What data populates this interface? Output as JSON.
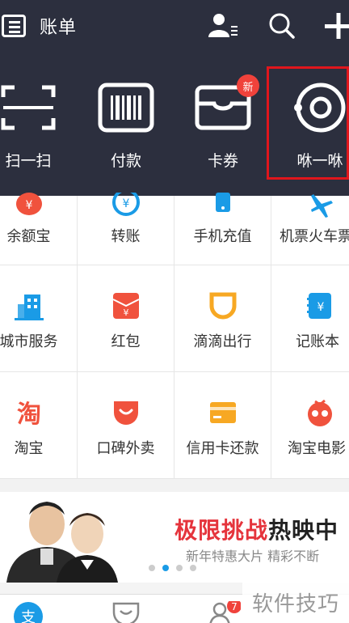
{
  "header": {
    "title": "账单",
    "icons": [
      "bill-icon",
      "contacts-icon",
      "search-icon",
      "plus-icon"
    ]
  },
  "actions": [
    {
      "label": "扫一扫",
      "icon": "scan-icon"
    },
    {
      "label": "付款",
      "icon": "barcode-icon"
    },
    {
      "label": "卡券",
      "icon": "card-voucher-icon",
      "badge": "新"
    },
    {
      "label": "咻一咻",
      "icon": "xiu-icon"
    }
  ],
  "grid": [
    {
      "label": "余额宝",
      "icon": "yuebao-icon",
      "color": "#f0523d"
    },
    {
      "label": "转账",
      "icon": "transfer-icon",
      "color": "#1a9be6"
    },
    {
      "label": "手机充值",
      "icon": "phone-recharge-icon",
      "color": "#1a9be6"
    },
    {
      "label": "机票火车票",
      "icon": "plane-icon",
      "color": "#1a9be6"
    },
    {
      "label": "城市服务",
      "icon": "city-icon",
      "color": "#1a9be6"
    },
    {
      "label": "红包",
      "icon": "red-envelope-icon",
      "color": "#f0523d"
    },
    {
      "label": "滴滴出行",
      "icon": "didi-icon",
      "color": "#f7a823"
    },
    {
      "label": "记账本",
      "icon": "ledger-icon",
      "color": "#1a9be6"
    },
    {
      "label": "淘宝",
      "icon": "taobao-icon",
      "color": "#f0523d"
    },
    {
      "label": "口碑外卖",
      "icon": "koubei-icon",
      "color": "#f0523d"
    },
    {
      "label": "信用卡还款",
      "icon": "credit-card-icon",
      "color": "#f7a823"
    },
    {
      "label": "淘宝电影",
      "icon": "taobao-movie-icon",
      "color": "#f0523d"
    }
  ],
  "banner": {
    "title_red": "极限挑战",
    "title_dark": "热映中",
    "subtitle": "新年特惠大片 精彩不断",
    "active_dot": 2
  },
  "tabbar": {
    "icons": [
      "alipay-tab-icon",
      "koubei-tab-icon",
      "friends-tab-icon"
    ],
    "badge": "7"
  },
  "watermark": "软件技巧",
  "colors": {
    "header_bg": "#2c2f3e",
    "accent_blue": "#1a9be6",
    "accent_red": "#f0523d",
    "highlight": "#e0161c"
  }
}
